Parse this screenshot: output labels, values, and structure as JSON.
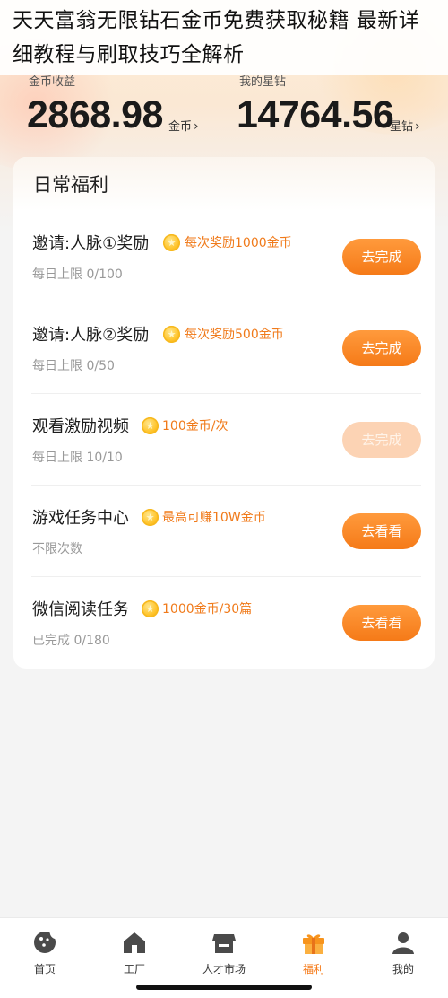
{
  "overlay_title": "天天富翁无限钻石金币免费获取秘籍 最新详细教程与刷取技巧全解析",
  "stats": {
    "coins": {
      "label": "金币收益",
      "value": "2868.98",
      "unit": "金币",
      "chevron": "›"
    },
    "stars": {
      "label": "我的星钻",
      "value": "14764.56",
      "unit": "星钻",
      "chevron": "›"
    }
  },
  "section_title": "日常福利",
  "tasks": [
    {
      "name": "邀请:人脉①奖励",
      "reward": "每次奖励1000金币",
      "limit": "每日上限 0/100",
      "button": "去完成",
      "enabled": true,
      "icon": "coin-icon"
    },
    {
      "name": "邀请:人脉②奖励",
      "reward": "每次奖励500金币",
      "limit": "每日上限 0/50",
      "button": "去完成",
      "enabled": true,
      "icon": "coin-icon"
    },
    {
      "name": "观看激励视频",
      "reward": "100金币/次",
      "limit": "每日上限 10/10",
      "button": "去完成",
      "enabled": false,
      "icon": "coin-icon"
    },
    {
      "name": "游戏任务中心",
      "reward": "最高可赚10W金币",
      "limit": "不限次数",
      "button": "去看看",
      "enabled": true,
      "icon": "coin-icon"
    },
    {
      "name": "微信阅读任务",
      "reward": "1000金币/30篇",
      "limit": "已完成 0/180",
      "button": "去看看",
      "enabled": true,
      "icon": "coin-icon"
    }
  ],
  "tabbar": [
    {
      "label": "首页",
      "icon": "home-cookie-icon",
      "active": false
    },
    {
      "label": "工厂",
      "icon": "factory-icon",
      "active": false
    },
    {
      "label": "人才市场",
      "icon": "market-icon",
      "active": false
    },
    {
      "label": "福利",
      "icon": "gift-icon",
      "active": true
    },
    {
      "label": "我的",
      "icon": "profile-icon",
      "active": false
    }
  ],
  "colors": {
    "accent": "#f57a18",
    "reward_text": "#f07a1a",
    "button_disabled": "#fcd3b4"
  }
}
